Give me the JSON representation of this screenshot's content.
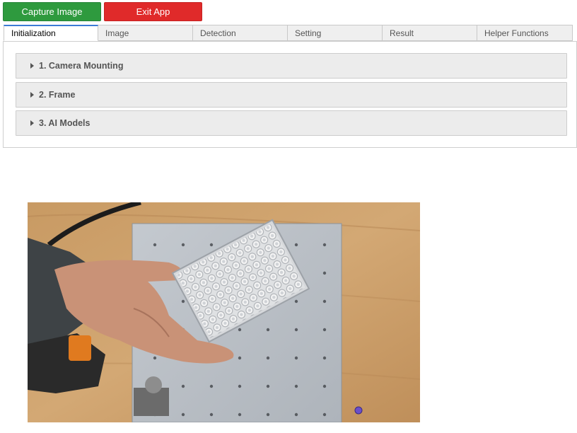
{
  "toolbar": {
    "capture_label": "Capture Image",
    "exit_label": "Exit App"
  },
  "tabs": [
    {
      "label": "Initialization",
      "active": true
    },
    {
      "label": "Image"
    },
    {
      "label": "Detection"
    },
    {
      "label": "Setting"
    },
    {
      "label": "Result"
    },
    {
      "label": "Helper Functions"
    }
  ],
  "accordion": [
    {
      "label": "1. Camera Mounting"
    },
    {
      "label": "2. Frame"
    },
    {
      "label": "3. AI Models"
    }
  ],
  "colors": {
    "capture_button": "#2e9a3e",
    "exit_button": "#e02a2a",
    "active_tab_accent": "#3b7bd6"
  }
}
